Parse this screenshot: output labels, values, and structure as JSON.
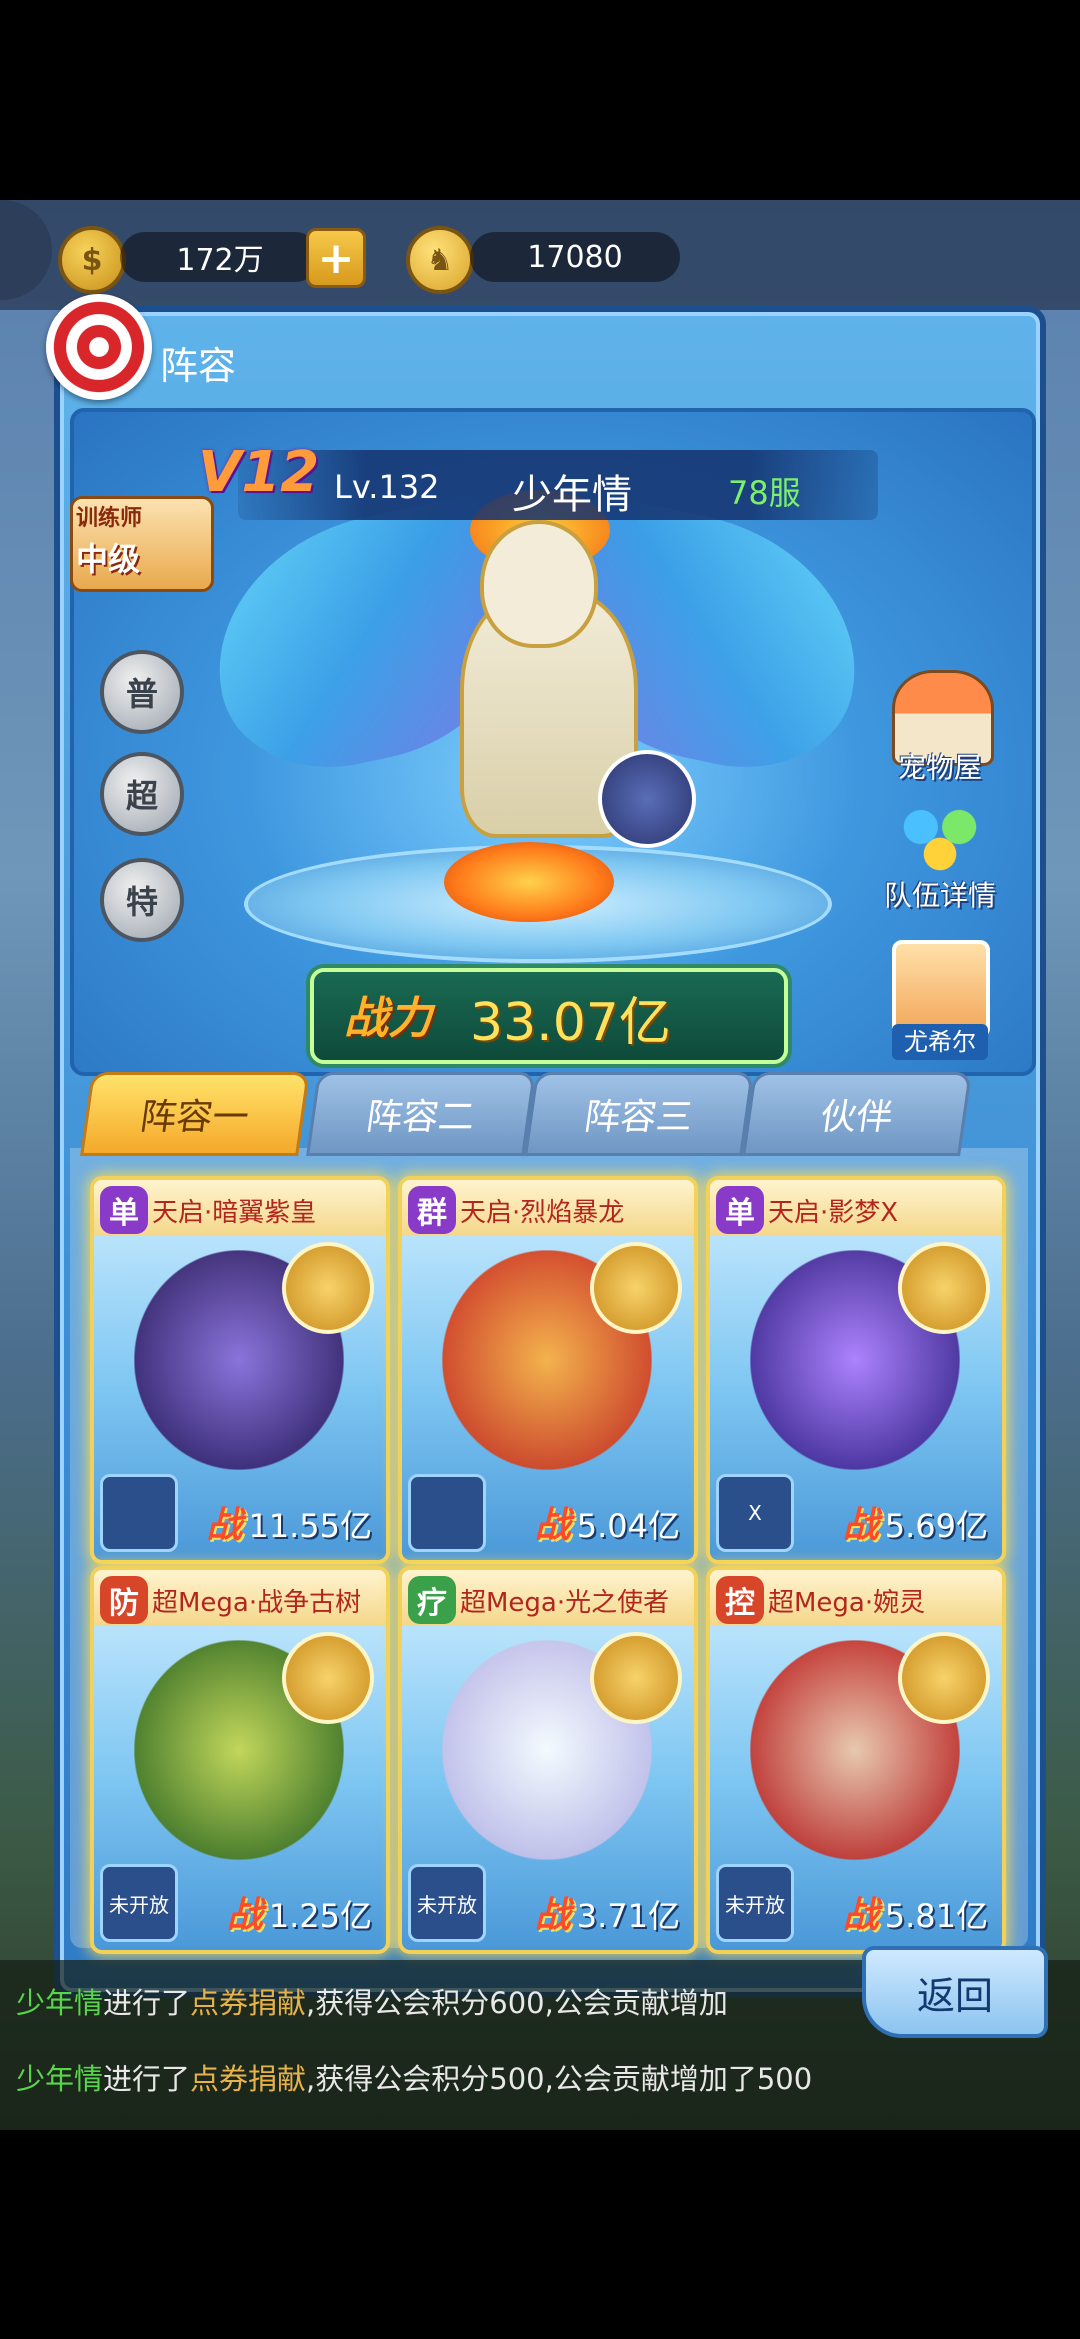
{
  "topbar": {
    "gold": "172万",
    "coin_icon": "gold-coin-icon",
    "diamonds": "17080",
    "bunny_icon": "bunny-currency-icon"
  },
  "panel": {
    "title": "阵容"
  },
  "player": {
    "vip": "V12",
    "level": "Lv.132",
    "name": "少年情",
    "server": "78服",
    "trainer_label": "训练师",
    "trainer_rank": "中级"
  },
  "grades": [
    "普",
    "超",
    "特"
  ],
  "side_buttons": {
    "pet_house": "宠物屋",
    "team_details": "队伍详情",
    "hero": "尤希尔"
  },
  "power": {
    "label": "战力",
    "value": "33.07亿"
  },
  "tabs": [
    "阵容一",
    "阵容二",
    "阵容三",
    "伙伴"
  ],
  "cards": [
    {
      "role": "单",
      "role_color": "#8a3ac8",
      "name": "天启·暗翼紫皇",
      "item": "",
      "power": "11.55亿",
      "portrait_color": "#5a3aa0"
    },
    {
      "role": "群",
      "role_color": "#8a3ac8",
      "name": "天启·烈焰暴龙",
      "item": "",
      "power": "5.04亿",
      "portrait_color": "#e0501a"
    },
    {
      "role": "单",
      "role_color": "#8a3ac8",
      "name": "天启·影梦X",
      "item": "X",
      "power": "5.69亿",
      "portrait_color": "#7a4ad0"
    },
    {
      "role": "防",
      "role_color": "#d8462a",
      "name": "超Mega·战争古树",
      "item": "未开放",
      "power": "1.25亿",
      "portrait_color": "#7a9a2a"
    },
    {
      "role": "疗",
      "role_color": "#3aa04a",
      "name": "超Mega·光之使者",
      "item": "未开放",
      "power": "3.71亿",
      "portrait_color": "#d9d2f2"
    },
    {
      "role": "控",
      "role_color": "#d8462a",
      "name": "超Mega·婉灵",
      "item": "未开放",
      "power": "5.81亿",
      "portrait_color": "#c8342a"
    }
  ],
  "power_prefix": "战",
  "back_button": "返回",
  "messages": [
    {
      "name": "少年情",
      "mid": "进行了",
      "action": "点券捐献",
      "tail": ",获得公会积分600,公会贡献增加"
    },
    {
      "name": "少年情",
      "mid": "进行了",
      "action": "点券捐献",
      "tail": ",获得公会积分500,公会贡献增加了500"
    }
  ]
}
